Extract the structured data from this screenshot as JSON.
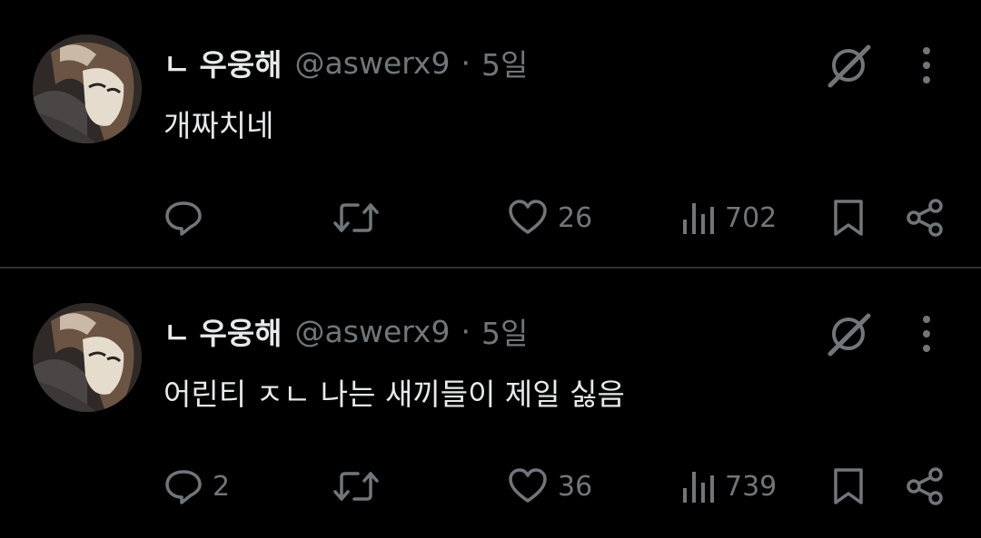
{
  "tweets": [
    {
      "reply_glyph": "ㄴ",
      "name": "우웅해",
      "handle": "@aswerx9",
      "separator": "·",
      "time": "5일",
      "text": "개짜치네",
      "actions": {
        "reply_count": "",
        "retweet_count": "",
        "like_count": "26",
        "view_count": "702"
      }
    },
    {
      "reply_glyph": "ㄴ",
      "name": "우웅해",
      "handle": "@aswerx9",
      "separator": "·",
      "time": "5일",
      "text": "어린티 ㅈㄴ 나는 새끼들이 제일 싫음",
      "actions": {
        "reply_count": "2",
        "retweet_count": "",
        "like_count": "36",
        "view_count": "739"
      }
    }
  ],
  "colors": {
    "background": "#000000",
    "primary_text": "#e7e9ea",
    "secondary_text": "#71767b",
    "divider": "#2f3336"
  },
  "icons": [
    "grok-icon",
    "more-icon",
    "reply-icon",
    "retweet-icon",
    "like-icon",
    "views-icon",
    "bookmark-icon",
    "share-icon"
  ]
}
